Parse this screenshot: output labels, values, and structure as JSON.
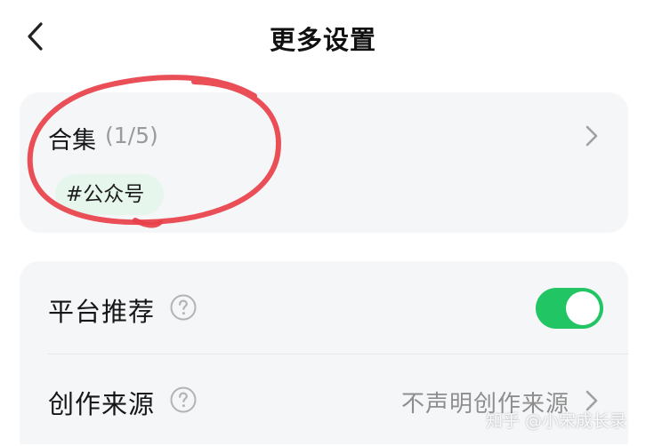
{
  "header": {
    "title": "更多设置",
    "back_icon": "chevron-left-icon"
  },
  "collection": {
    "label": "合集",
    "count": "(1/5)",
    "tag": "#公众号",
    "chevron_icon": "chevron-right-icon",
    "annotation_color": "#e8404a"
  },
  "settings": {
    "platform_recommend": {
      "label": "平台推荐",
      "help_icon": "question-circle-icon",
      "toggle_on": true,
      "toggle_color": "#22c564"
    },
    "creation_source": {
      "label": "创作来源",
      "help_icon": "question-circle-icon",
      "value": "不声明创作来源",
      "chevron_icon": "chevron-right-icon"
    }
  },
  "watermark": "知乎 @小宋成长录"
}
